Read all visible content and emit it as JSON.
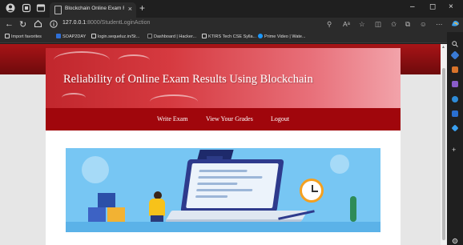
{
  "browser": {
    "tab_title": "Blockchain Online Exam Results",
    "tab_close": "×",
    "new_tab": "+",
    "url_host": "127.0.0.1",
    "url_path": ":8000/StudentLoginAction",
    "window_controls": {
      "minimize": "–",
      "maximize": "◻",
      "close": "×"
    },
    "bookmarks": [
      {
        "label": "Import favorites",
        "icon": "folder-icon",
        "color": "#d8d8d8"
      },
      {
        "label": "SOAP2DAY",
        "icon": "site-icon",
        "color": "#2f6fd6"
      },
      {
        "label": "login.sequeluz.in/St...",
        "icon": "page-icon",
        "color": "#d8d8d8"
      },
      {
        "label": "Dashboard | Hacker...",
        "icon": "hackerrank-icon",
        "color": "#1e1e1e"
      },
      {
        "label": "KTIRS Tech CSE Sylla...",
        "icon": "page-icon",
        "color": "#d8d8d8"
      },
      {
        "label": "Prime Video | Wate...",
        "icon": "prime-video-icon",
        "color": "#1a98ff"
      }
    ]
  },
  "site": {
    "title": "Reliability of Online Exam Results Using Blockchain",
    "nav": [
      {
        "label": "Write Exam"
      },
      {
        "label": "View Your Grades"
      },
      {
        "label": "Logout"
      }
    ]
  },
  "colors": {
    "top_strip": "#a81417",
    "banner_start": "#c1272d",
    "banner_end": "#f2a3aa",
    "navbar": "#a0060c",
    "hero_bg": "#77c6f3"
  }
}
